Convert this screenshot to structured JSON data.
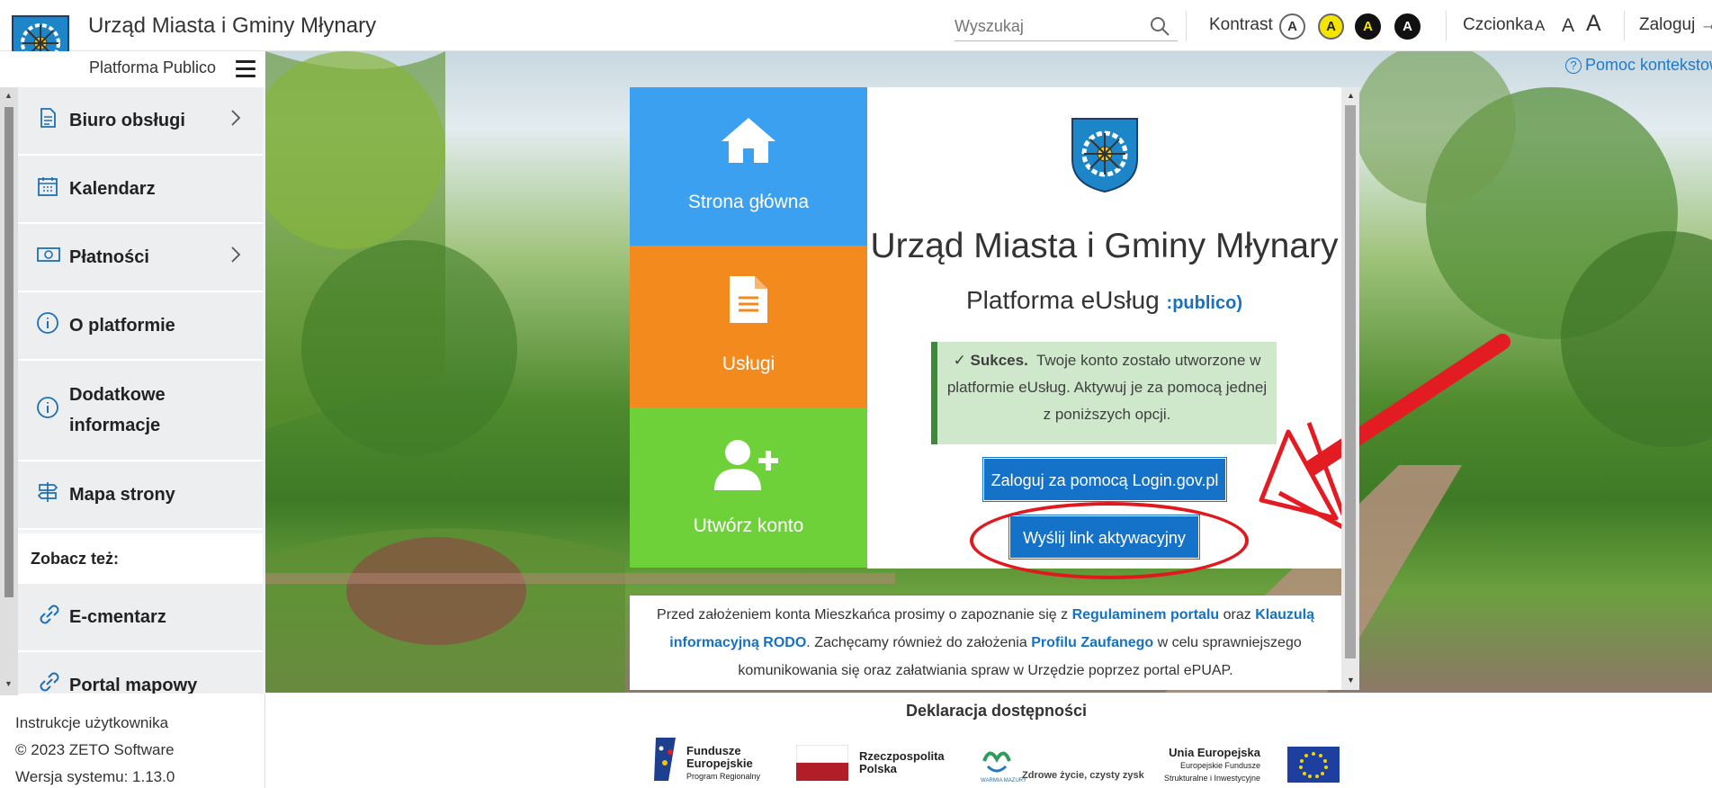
{
  "header": {
    "org_title": "Urząd Miasta i Gminy Młynary",
    "search_placeholder": "Wyszukaj",
    "kontrast_label": "Kontrast",
    "kontrast_options": [
      "A",
      "A",
      "A",
      "A"
    ],
    "czcionka_label": "Czcionka",
    "font_sizes": [
      "A",
      "A",
      "A"
    ],
    "login_label": "Zaloguj"
  },
  "subheader": {
    "platform_label": "Platforma Publico",
    "help_label": "Pomoc kontekstow"
  },
  "sidebar": {
    "items": [
      {
        "label": "Biuro obsługi",
        "icon": "document-icon",
        "has_children": true
      },
      {
        "label": "Kalendarz",
        "icon": "calendar-icon",
        "has_children": false
      },
      {
        "label": "Płatności",
        "icon": "money-icon",
        "has_children": true
      },
      {
        "label": "O platformie",
        "icon": "info-icon",
        "has_children": false
      },
      {
        "label": "Dodatkowe informacje",
        "icon": "info-icon",
        "has_children": false
      },
      {
        "label": "Mapa strony",
        "icon": "signpost-icon",
        "has_children": false
      }
    ],
    "see_also_label": "Zobacz też:",
    "see_also": [
      {
        "label": "E-cmentarz",
        "icon": "link-icon"
      },
      {
        "label": "Portal mapowy",
        "icon": "link-icon"
      }
    ],
    "footer": {
      "manual": "Instrukcje użytkownika",
      "copyright": "© 2023 ZETO Software",
      "version": "Wersja systemu: 1.13.0"
    }
  },
  "tiles": [
    {
      "label": "Strona główna",
      "icon": "home-icon",
      "color": "#3ba0f0"
    },
    {
      "label": "Usługi",
      "icon": "file-icon",
      "color": "#f38a1e"
    },
    {
      "label": "Utwórz konto",
      "icon": "add-user-icon",
      "color": "#6fd13a"
    }
  ],
  "panel": {
    "org_title": "Urząd Miasta i Gminy Młynary",
    "platform_text": "Platforma eUsług",
    "publico_brand": "publico)",
    "alert_title": "Sukces.",
    "alert_text": "Twoje konto zostało utworzone w platformie eUsług. Aktywuj je za pomocą jednej z poniższych opcji.",
    "login_gov_button": "Zaloguj za pomocą Login.gov.pl",
    "send_link_button": "Wyślij link aktywacyjny"
  },
  "info": {
    "t1": "Przed założeniem konta Mieszkańca prosimy o zapoznanie się z",
    "l1": "Regulaminem portalu",
    "t2": "oraz",
    "l2": "Klauzulą informacyjną RODO",
    "t3": ". Zachęcamy również do założenia",
    "l3": "Profilu Zaufanego",
    "t4": "w celu sprawniejszego komunikowania się oraz załatwiania spraw w Urzędzie poprzez portal ePUAP."
  },
  "footer": {
    "declaration": "Deklaracja dostępności",
    "fe_line1": "Fundusze",
    "fe_line2": "Europejskie",
    "fe_line3": "Program Regionalny",
    "rp_line1": "Rzeczpospolita",
    "rp_line2": "Polska",
    "wm_small": "WARMIA MAZURY",
    "wm_slogan": "Zdrowe życie, czysty zysk",
    "ue_line1": "Unia Europejska",
    "ue_line2": "Europejskie Fundusze",
    "ue_line3": "Strukturalne i Inwestycyjne"
  },
  "colors": {
    "accent_blue": "#1572c9",
    "success_bg": "#cfe8cc",
    "annotation_red": "#e0191e",
    "kontrast_yellow": "#f5e400"
  }
}
